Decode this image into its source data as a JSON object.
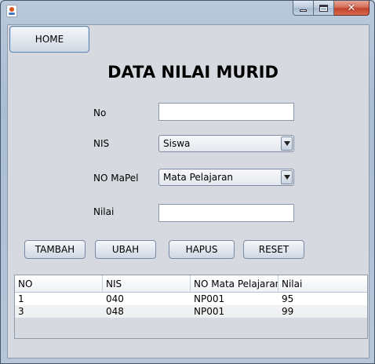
{
  "window": {
    "title": "",
    "controls": {
      "minimize_icon": "minimize-icon",
      "maximize_icon": "maximize-icon",
      "close_glyph": "✕"
    }
  },
  "nav": {
    "home_label": "HOME"
  },
  "form": {
    "title": "DATA NILAI MURID",
    "no_label": "No",
    "no_value": "",
    "nis_label": "NIS",
    "nis_selected": "Siswa",
    "mapel_label": "NO MaPel",
    "mapel_selected": "Mata Pelajaran",
    "nilai_label": "Nilai",
    "nilai_value": ""
  },
  "actions": {
    "tambah": "TAMBAH",
    "ubah": "UBAH",
    "hapus": "HAPUS",
    "reset": "RESET"
  },
  "table": {
    "columns": [
      "NO",
      "NIS",
      "NO Mata Pelajaran",
      "Nilai"
    ],
    "rows": [
      [
        "1",
        "040",
        "NP001",
        "95"
      ],
      [
        "3",
        "048",
        "NP001",
        "99"
      ]
    ]
  },
  "colors": {
    "pane_bg": "#d6d9df",
    "frame": "#a9bdd4",
    "close": "#c1412a"
  }
}
